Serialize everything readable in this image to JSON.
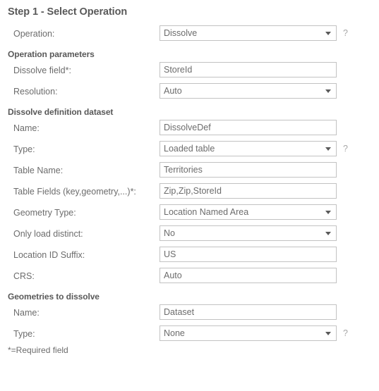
{
  "page_title": "Step 1 - Select Operation",
  "footnote": "*=Required field",
  "help_icon": "?",
  "colors": {
    "text": "#6c6c6c",
    "heading": "#595959",
    "border": "#c2c2c2",
    "background": "#ffffff",
    "help": "#a8a8a8"
  },
  "rows": [
    {
      "label": "Operation:",
      "type": "select",
      "value": "Dissolve",
      "help": true,
      "name": "operation"
    },
    {
      "header": "Operation parameters",
      "name": "operation-parameters"
    },
    {
      "label": "Dissolve field*:",
      "type": "text",
      "value": "StoreId",
      "help": false,
      "name": "dissolve-field"
    },
    {
      "label": "Resolution:",
      "type": "select",
      "value": "Auto",
      "help": false,
      "name": "resolution"
    },
    {
      "header": "Dissolve definition dataset",
      "name": "dissolve-definition-dataset"
    },
    {
      "label": "Name:",
      "type": "text",
      "value": "DissolveDef",
      "help": false,
      "name": "dissolve-def-name"
    },
    {
      "label": "Type:",
      "type": "select",
      "value": "Loaded table",
      "help": true,
      "name": "dissolve-def-type"
    },
    {
      "label": "Table Name:",
      "type": "text",
      "value": "Territories",
      "help": false,
      "name": "table-name"
    },
    {
      "label": "Table Fields (key,geometry,...)*:",
      "type": "text",
      "value": "Zip,Zip,StoreId",
      "help": false,
      "name": "table-fields"
    },
    {
      "label": "Geometry Type:",
      "type": "select",
      "value": "Location Named Area",
      "help": false,
      "name": "geometry-type"
    },
    {
      "label": "Only load distinct:",
      "type": "select",
      "value": "No",
      "help": false,
      "name": "only-load-distinct"
    },
    {
      "label": "Location ID Suffix:",
      "type": "text",
      "value": "US",
      "help": false,
      "name": "location-id-suffix"
    },
    {
      "label": "CRS:",
      "type": "text",
      "value": "Auto",
      "help": false,
      "name": "crs"
    },
    {
      "header": "Geometries to dissolve",
      "name": "geometries-to-dissolve"
    },
    {
      "label": "Name:",
      "type": "text",
      "value": "Dataset",
      "help": false,
      "name": "geometries-name"
    },
    {
      "label": "Type:",
      "type": "select",
      "value": "None",
      "help": true,
      "name": "geometries-type"
    }
  ]
}
